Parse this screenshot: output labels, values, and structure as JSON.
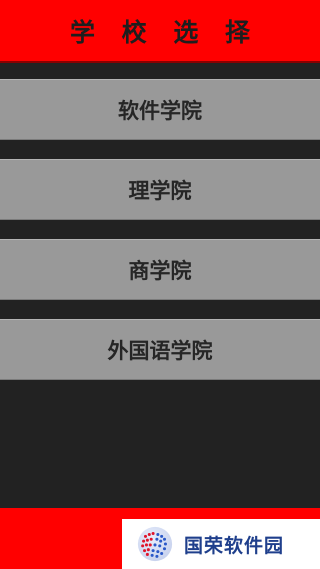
{
  "header": {
    "title": "学 校 选 择"
  },
  "schools": [
    {
      "label": "软件学院"
    },
    {
      "label": "理学院"
    },
    {
      "label": "商学院"
    },
    {
      "label": "外国语学院"
    }
  ],
  "watermark": {
    "text": "国荣软件园",
    "icon": "globe-logo-icon"
  },
  "colors": {
    "header_bg": "#ff0000",
    "page_bg": "#222222",
    "item_bg": "#999999",
    "item_text": "#262626",
    "watermark_text": "#1f3f8c"
  }
}
